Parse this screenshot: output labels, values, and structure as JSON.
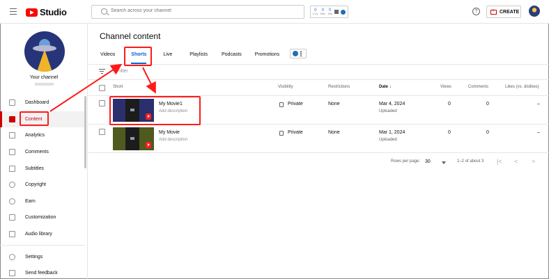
{
  "app": {
    "logo_text": "Studio"
  },
  "search": {
    "placeholder": "Search across your channel"
  },
  "extension": {
    "stats": [
      {
        "value": "0",
        "label": "0.1y"
      },
      {
        "value": "0",
        "label": "60m"
      },
      {
        "value": "0",
        "label": "48h"
      }
    ]
  },
  "topbar": {
    "create_label": "CREATE",
    "help_glyph": "?"
  },
  "channel": {
    "title": "Your channel"
  },
  "sidebar": {
    "items": [
      {
        "label": "Dashboard",
        "icon": "dashboard-icon"
      },
      {
        "label": "Content",
        "icon": "content-icon",
        "active": true
      },
      {
        "label": "Analytics",
        "icon": "analytics-icon"
      },
      {
        "label": "Comments",
        "icon": "comments-icon"
      },
      {
        "label": "Subtitles",
        "icon": "subtitles-icon"
      },
      {
        "label": "Copyright",
        "icon": "copyright-icon"
      },
      {
        "label": "Earn",
        "icon": "earn-icon"
      },
      {
        "label": "Customization",
        "icon": "customization-icon"
      },
      {
        "label": "Audio library",
        "icon": "audio-library-icon"
      }
    ],
    "bottom": [
      {
        "label": "Settings",
        "icon": "settings-icon"
      },
      {
        "label": "Send feedback",
        "icon": "feedback-icon"
      }
    ]
  },
  "page": {
    "title": "Channel content"
  },
  "tabs": [
    "Videos",
    "Shorts",
    "Live",
    "Playlists",
    "Podcasts",
    "Promotions"
  ],
  "active_tab": "Shorts",
  "filter": {
    "label": "Filter"
  },
  "table": {
    "headers": {
      "short": "Short",
      "visibility": "Visibility",
      "restrictions": "Restrictions",
      "date": "Date",
      "date_sort": "↓",
      "views": "Views",
      "comments": "Comments",
      "likes": "Likes (vs. dislikes)"
    },
    "rows": [
      {
        "title": "My Movie1",
        "description": "Add description",
        "visibility": "Private",
        "restrictions": "None",
        "date": "Mar 4, 2024",
        "status": "Uploaded",
        "views": "0",
        "comments": "0",
        "likes": "–",
        "thumb_color": "#2b2f6e"
      },
      {
        "title": "My Movie",
        "description": "Add description",
        "visibility": "Private",
        "restrictions": "None",
        "date": "Mar 1, 2024",
        "status": "Uploaded",
        "views": "0",
        "comments": "0",
        "likes": "–",
        "thumb_color": "#4e5a1e"
      }
    ]
  },
  "pagination": {
    "rows_label": "Rows per page:",
    "rows_value": "30",
    "range": "1–2 of about 3",
    "first": "|<",
    "prev": "<",
    "next": ">",
    "last": ">|"
  },
  "colors": {
    "accent": "#065fd4",
    "brand": "#ff0000",
    "annotation": "#ff1a1a"
  }
}
